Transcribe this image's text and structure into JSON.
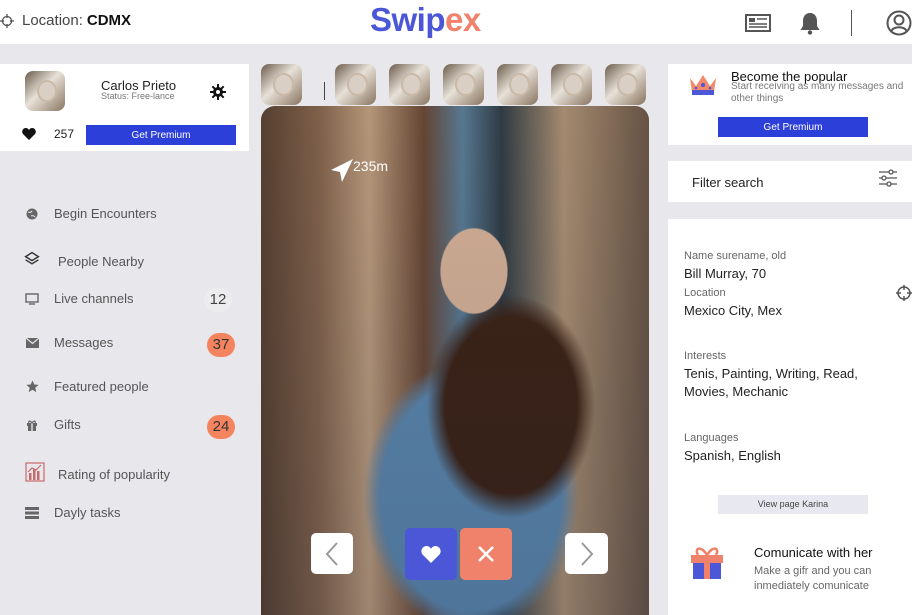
{
  "header": {
    "location_label": "Location:",
    "location_value": "CDMX",
    "logo_part1": "Swip",
    "logo_part2": "ex"
  },
  "profile": {
    "name": "Carlos Prieto",
    "status": "Status: Free-lance",
    "likes": "257",
    "premium_button": "Get Premium"
  },
  "menu": {
    "items": [
      {
        "label": "Begin Encounters",
        "icon": "globe-icon"
      },
      {
        "label": "People Nearby",
        "icon": "layers-icon"
      },
      {
        "label": "Live channels",
        "icon": "monitor-icon"
      },
      {
        "label": "Messages",
        "icon": "envelope-icon"
      },
      {
        "label": "Featured people",
        "icon": "star-icon"
      },
      {
        "label": "Gifts",
        "icon": "gift-icon"
      },
      {
        "label": "Rating of popularity",
        "icon": "chart-icon"
      },
      {
        "label": "Dayly tasks",
        "icon": "tasks-icon"
      }
    ],
    "badges": {
      "live": "12",
      "messages": "37",
      "gifts": "24"
    }
  },
  "card": {
    "distance": "235m"
  },
  "popular": {
    "title": "Become the popular",
    "subtitle": "Start receiving as many messages and other things",
    "button": "Get Premium"
  },
  "filter": {
    "label": "Filter search"
  },
  "details": {
    "name_label": "Name surename, old",
    "name_value": "Bill Murray, 70",
    "location_label": "Location",
    "location_value": "Mexico City, Mex",
    "interests_label": "Interests",
    "interests_value": "Tenis, Painting, Writing, Read, Movies, Mechanic",
    "languages_label": "Languages",
    "languages_value": "Spanish, English",
    "view_button": "View page Karina"
  },
  "communicate": {
    "title": "Comunicate with her",
    "text": "Make a gifr and you can inmediately comunicate"
  },
  "colors": {
    "brand_blue": "#4b57d6",
    "brand_orange": "#f0826b",
    "premium_button": "#2c3fd9",
    "badge_orange": "#f4845f"
  }
}
